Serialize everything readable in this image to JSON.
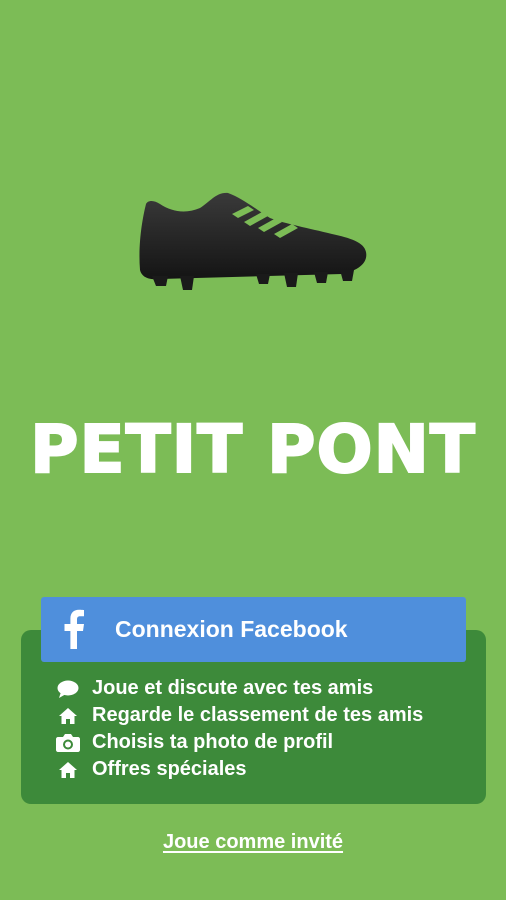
{
  "app": {
    "logo_text": "PETIT PONT"
  },
  "login": {
    "facebook_button_label": "Connexion Facebook"
  },
  "features": [
    {
      "icon": "speech-bubble-icon",
      "label": "Joue et discute avec tes amis"
    },
    {
      "icon": "home-icon",
      "label": "Regarde le classement de tes amis"
    },
    {
      "icon": "camera-icon",
      "label": "Choisis ta photo de profil"
    },
    {
      "icon": "home-icon",
      "label": "Offres spéciales"
    }
  ],
  "guest": {
    "link_label": "Joue comme invité"
  },
  "colors": {
    "background": "#7cbc56",
    "panel": "#3d8a3a",
    "facebook_blue": "#4f8fdc",
    "boot": "#222222"
  }
}
